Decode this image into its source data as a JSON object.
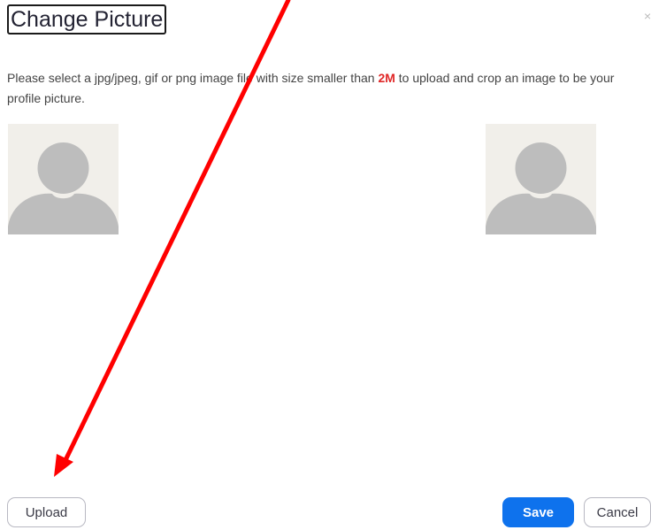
{
  "dialog": {
    "title": "Change Picture",
    "close_glyph": "×",
    "description": {
      "before": "Please select a jpg/jpeg, gif or png image file with size smaller than ",
      "size_limit": "2M",
      "after": " to upload and crop an image to be your profile picture."
    }
  },
  "avatars": {
    "icon": "user-silhouette-icon",
    "background_color": "#f1efea",
    "silhouette_color": "#bdbdbd"
  },
  "footer": {
    "upload_label": "Upload",
    "save_label": "Save",
    "cancel_label": "Cancel"
  },
  "colors": {
    "primary": "#0e72ed",
    "size_highlight": "#e02828",
    "annotation_arrow": "#ff0000"
  }
}
